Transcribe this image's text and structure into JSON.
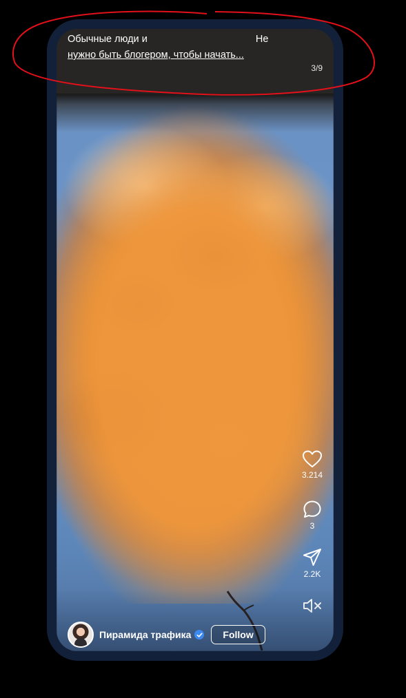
{
  "post": {
    "caption_line1": "Обычные люди и                                       Не",
    "caption_line2": "нужно быть блогером, чтобы начать...",
    "slide_counter": "3/9"
  },
  "actions": {
    "like_count": "3.214",
    "comment_count": "3",
    "share_count": "2.2K"
  },
  "author": {
    "name": "Пирамида трафика",
    "follow_label": "Follow"
  },
  "icons": {
    "like": "heart-icon",
    "comment": "comment-icon",
    "share": "send-icon",
    "mute": "speaker-muted-icon",
    "verified": "verified-badge-icon"
  },
  "colors": {
    "frame": "#13203a",
    "verified": "#3c8af0",
    "annotation": "#e4101a"
  }
}
